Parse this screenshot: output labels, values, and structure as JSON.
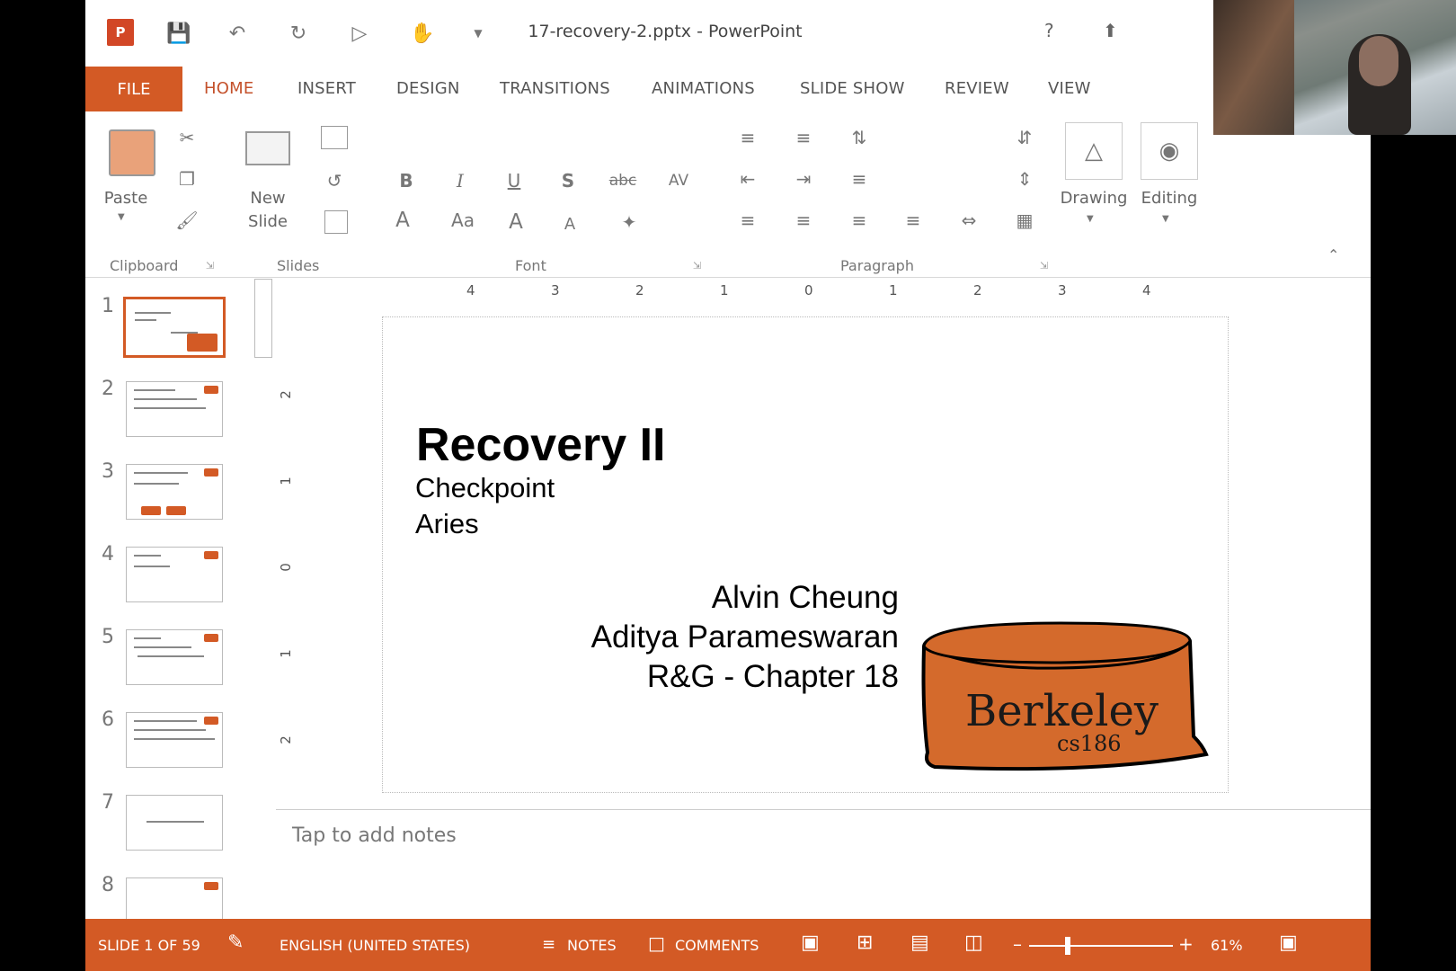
{
  "window": {
    "doc_title": "17-recovery-2.pptx - PowerPoint",
    "logo_text": "P"
  },
  "tabs": {
    "file": "FILE",
    "items": [
      "HOME",
      "INSERT",
      "DESIGN",
      "TRANSITIONS",
      "ANIMATIONS",
      "SLIDE SHOW",
      "REVIEW",
      "VIEW"
    ],
    "active": "HOME"
  },
  "ribbon": {
    "paste": "Paste",
    "new_slide_1": "New",
    "new_slide_2": "Slide",
    "drawing": "Drawing",
    "editing": "Editing",
    "groups": {
      "clipboard": "Clipboard",
      "slides": "Slides",
      "font": "Font",
      "paragraph": "Paragraph"
    },
    "font_buttons": {
      "bold": "B",
      "italic": "I",
      "underline": "U",
      "shadow": "S",
      "strike": "abc",
      "spacing": "AV",
      "font_color": "A",
      "change_case": "Aa",
      "grow": "A",
      "shrink": "A"
    }
  },
  "ruler": {
    "h_numbers": [
      "4",
      "3",
      "2",
      "1",
      "0",
      "1",
      "2",
      "3",
      "4"
    ],
    "v_numbers": [
      "2",
      "1",
      "0",
      "1",
      "2"
    ]
  },
  "thumbnails": [
    "1",
    "2",
    "3",
    "4",
    "5",
    "6",
    "7",
    "8"
  ],
  "slide": {
    "title": "Recovery II",
    "subtitle_1": "Checkpoint",
    "subtitle_2": "Aries",
    "author_1": "Alvin Cheung",
    "author_2": "Aditya Parameswaran",
    "author_3": "R&G - Chapter 18",
    "logo_main": "Berkeley",
    "logo_sub": "cs186"
  },
  "notes": {
    "placeholder": "Tap to add notes"
  },
  "status": {
    "slide_info": "SLIDE 1 OF 59",
    "language": "ENGLISH (UNITED STATES)",
    "notes": "NOTES",
    "comments": "COMMENTS",
    "zoom_minus": "–",
    "zoom_plus": "+",
    "zoom": "61%",
    "zoom_level_percent": 61
  },
  "colors": {
    "accent": "#d35a25",
    "logo_fill": "#d46a2c"
  }
}
